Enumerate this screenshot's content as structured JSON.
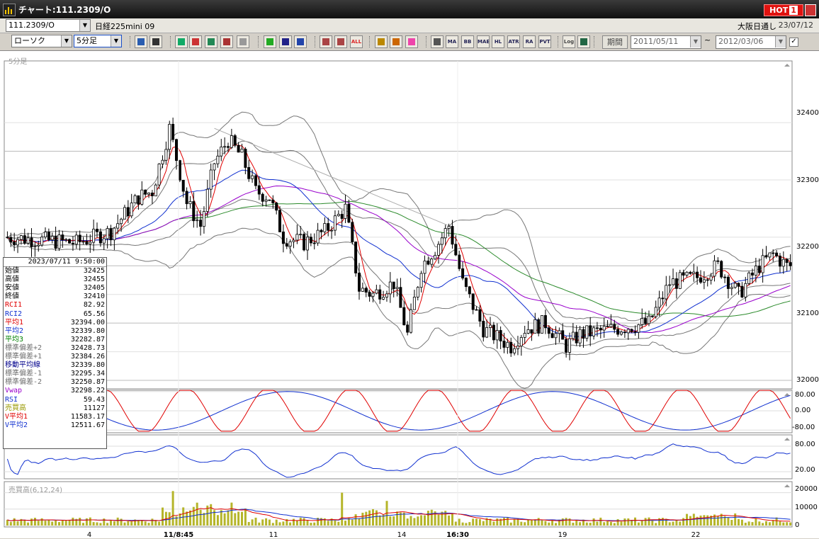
{
  "window": {
    "title": "チャート:111.2309/O",
    "hot_label": "HOT",
    "hot_number": "1"
  },
  "header": {
    "code": "111.2309/O",
    "name": "日経225mini 09",
    "market": "大阪日通し",
    "date": "23/07/12"
  },
  "toolbar": {
    "chart_type": "ローソク",
    "interval": "5分足",
    "period_button": "期間",
    "date_from": "2011/05/11",
    "date_to": "2012/03/06",
    "tilde": "~",
    "icons": [
      "zoom-icon",
      "grid-icon",
      "download-icon",
      "history-icon",
      "excel-icon",
      "compare-icon",
      "alert-icon",
      "pencil-icon",
      "cursor-icon",
      "eraser-icon",
      "candle-icon",
      "candle2-icon",
      "all-icon",
      "settings-icon",
      "tools-icon",
      "color-icon",
      "pattern-icon",
      "ma-icon",
      "bb-icon",
      "mae-icon",
      "hl-icon",
      "atr-icon",
      "ra-icon",
      "pvt-icon",
      "log-icon",
      "sub-icon"
    ],
    "icon_labels": [
      "",
      "",
      "",
      "",
      "",
      "",
      "",
      "",
      "",
      "",
      "",
      "",
      "ALL",
      "",
      "",
      "",
      "",
      "MA",
      "BB",
      "MAE",
      "HL",
      "ATR",
      "RA",
      "PVT",
      "Log",
      ""
    ]
  },
  "panels": {
    "main_label": "5分足",
    "volume_label": "売買高(6,12,24)"
  },
  "price_axis": [
    "32400",
    "32300",
    "32200",
    "32100",
    "32000"
  ],
  "rci_axis": [
    "80.00",
    "0.00",
    "-80.00"
  ],
  "rsi_axis": [
    "80.00",
    "20.00"
  ],
  "volume_axis": [
    "20000",
    "10000",
    "0"
  ],
  "x_labels": [
    "4",
    "11/8:45",
    "11",
    "14",
    "16:30",
    "19",
    "22"
  ],
  "info": {
    "datetime": "2023/07/11 9:50:00",
    "rows": [
      {
        "label": "始値",
        "value": "32425",
        "color": "#000000"
      },
      {
        "label": "高値",
        "value": "32455",
        "color": "#000000"
      },
      {
        "label": "安値",
        "value": "32405",
        "color": "#000000"
      },
      {
        "label": "終値",
        "value": "32410",
        "color": "#000000"
      },
      {
        "label": "RCI1",
        "value": "82.92",
        "color": "#e00000"
      },
      {
        "label": "RCI2",
        "value": "65.56",
        "color": "#1030d0"
      },
      {
        "label": "平均1",
        "value": "32394.00",
        "color": "#e00000"
      },
      {
        "label": "平均2",
        "value": "32339.80",
        "color": "#1030d0"
      },
      {
        "label": "平均3",
        "value": "32282.87",
        "color": "#008000"
      },
      {
        "label": "標準偏差+2",
        "value": "32428.73",
        "color": "#707070"
      },
      {
        "label": "標準偏差+1",
        "value": "32384.26",
        "color": "#707070"
      },
      {
        "label": "移動平均線",
        "value": "32339.80",
        "color": "#00008b"
      },
      {
        "label": "標準偏差-1",
        "value": "32295.34",
        "color": "#707070"
      },
      {
        "label": "標準偏差-2",
        "value": "32250.87",
        "color": "#707070"
      },
      {
        "label": "Vwap",
        "value": "32298.22",
        "color": "#9900cc"
      },
      {
        "label": "RSI",
        "value": "59.43",
        "color": "#1030d0"
      },
      {
        "label": "売買高",
        "value": "11127",
        "color": "#999900"
      },
      {
        "label": "V平均1",
        "value": "11583.17",
        "color": "#e00000"
      },
      {
        "label": "V平均2",
        "value": "12511.67",
        "color": "#1030d0"
      }
    ]
  },
  "colors": {
    "ma1": "#e00000",
    "ma2": "#1030d0",
    "ma3": "#2a8a2a",
    "vwap": "#9900cc",
    "band": "#777777",
    "volume": "#b5b52a"
  },
  "chart_data": {
    "type": "candlestick",
    "interval": "5分足",
    "price_range": [
      32000,
      32460
    ],
    "close_path_keyframes": [
      {
        "i": 0,
        "v": 32250
      },
      {
        "i": 20,
        "v": 32240
      },
      {
        "i": 30,
        "v": 32260
      },
      {
        "i": 38,
        "v": 32320
      },
      {
        "i": 42,
        "v": 32330
      },
      {
        "i": 47,
        "v": 32440
      },
      {
        "i": 52,
        "v": 32310
      },
      {
        "i": 56,
        "v": 32270
      },
      {
        "i": 60,
        "v": 32380
      },
      {
        "i": 64,
        "v": 32420
      },
      {
        "i": 68,
        "v": 32390
      },
      {
        "i": 72,
        "v": 32330
      },
      {
        "i": 76,
        "v": 32320
      },
      {
        "i": 80,
        "v": 32250
      },
      {
        "i": 86,
        "v": 32240
      },
      {
        "i": 92,
        "v": 32260
      },
      {
        "i": 98,
        "v": 32300
      },
      {
        "i": 102,
        "v": 32160
      },
      {
        "i": 106,
        "v": 32150
      },
      {
        "i": 112,
        "v": 32170
      },
      {
        "i": 116,
        "v": 32080
      },
      {
        "i": 120,
        "v": 32200
      },
      {
        "i": 124,
        "v": 32230
      },
      {
        "i": 128,
        "v": 32270
      },
      {
        "i": 132,
        "v": 32170
      },
      {
        "i": 138,
        "v": 32090
      },
      {
        "i": 146,
        "v": 32060
      },
      {
        "i": 150,
        "v": 32090
      },
      {
        "i": 156,
        "v": 32100
      },
      {
        "i": 162,
        "v": 32060
      },
      {
        "i": 166,
        "v": 32080
      },
      {
        "i": 176,
        "v": 32090
      },
      {
        "i": 186,
        "v": 32100
      },
      {
        "i": 192,
        "v": 32170
      },
      {
        "i": 200,
        "v": 32180
      },
      {
        "i": 206,
        "v": 32200
      },
      {
        "i": 212,
        "v": 32150
      },
      {
        "i": 218,
        "v": 32200
      },
      {
        "i": 222,
        "v": 32220
      },
      {
        "i": 226,
        "v": 32200
      }
    ],
    "rci1_period_bars": 24,
    "volume_spikes": [
      {
        "i": 48,
        "v": 21000
      },
      {
        "i": 97,
        "v": 20000
      },
      {
        "i": 110,
        "v": 15000
      },
      {
        "i": 122,
        "v": 9000
      }
    ]
  }
}
